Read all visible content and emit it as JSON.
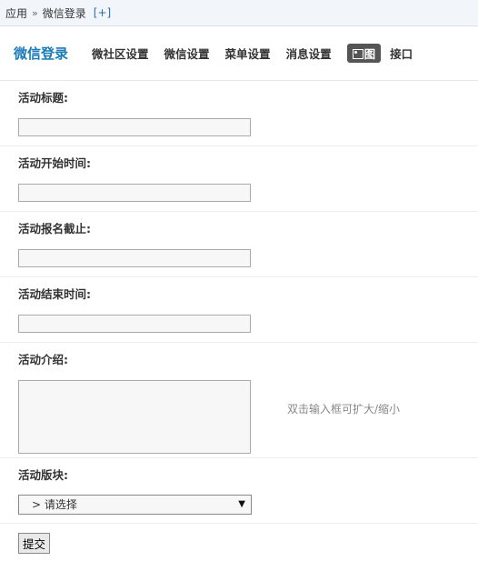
{
  "breadcrumb": {
    "root": "应用",
    "separator": "»",
    "current": "微信登录",
    "add": "[+]"
  },
  "nav": {
    "app_title": "微信登录",
    "tabs": [
      {
        "label": "微社区设置"
      },
      {
        "label": "微信设置"
      },
      {
        "label": "菜单设置"
      },
      {
        "label": "消息设置"
      },
      {
        "label": "图",
        "active": true
      },
      {
        "label": "接口"
      }
    ]
  },
  "form": {
    "title_label": "活动标题:",
    "title_value": "",
    "start_label": "活动开始时间:",
    "start_value": "",
    "deadline_label": "活动报名截止:",
    "deadline_value": "",
    "end_label": "活动结束时间:",
    "end_value": "",
    "intro_label": "活动介绍:",
    "intro_value": "",
    "intro_tip": "双击输入框可扩大/缩小",
    "section_label": "活动版块:",
    "section_selected": "> 请选择",
    "submit_label": "提交"
  },
  "colors": {
    "accent": "#1a7bb9",
    "active_tab_bg": "#555555",
    "topbar_bg": "#f2f6fb"
  }
}
